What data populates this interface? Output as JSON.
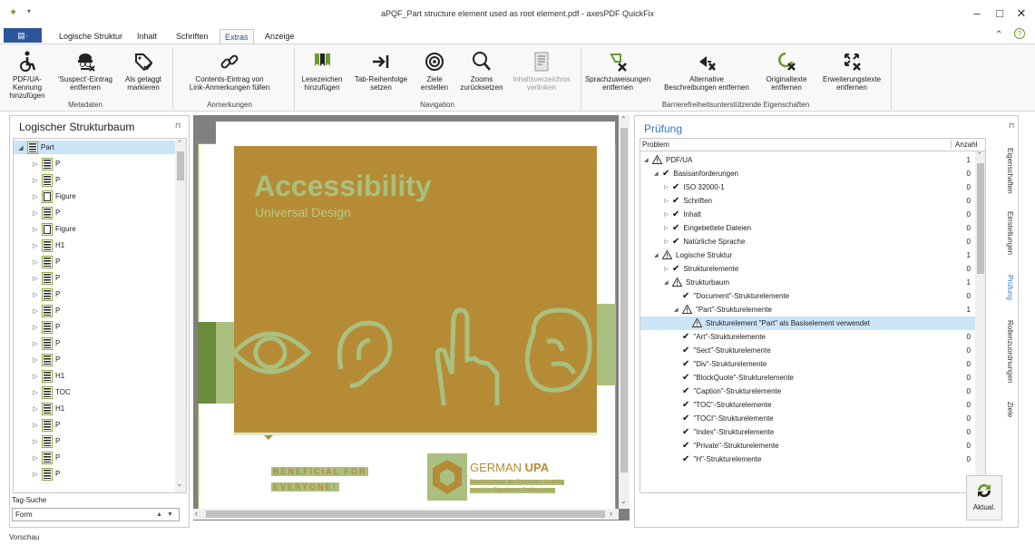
{
  "window": {
    "title": "aPQF_Part structure element used as root element.pdf - axesPDF QuickFix",
    "minimize": "–",
    "maximize": "□",
    "close": "✕"
  },
  "tabs": {
    "file": "▤·",
    "items": [
      "Logische Struktur",
      "Inhalt",
      "Schriften",
      "Extras",
      "Anzeige"
    ],
    "active": "Extras"
  },
  "ribbon": {
    "groups": [
      {
        "label": "Metadaten",
        "buttons": [
          {
            "l1": "PDF/UA-Kennung",
            "l2": "hinzufügen",
            "icon": "accessibility-icon"
          },
          {
            "l1": "'Suspect'-Eintrag",
            "l2": "entfernen",
            "icon": "spy-icon"
          },
          {
            "l1": "Als getaggt",
            "l2": "markieren",
            "icon": "tag-icon"
          }
        ]
      },
      {
        "label": "Anmerkungen",
        "buttons": [
          {
            "l1": "Contents-Eintrag von",
            "l2": "Link-Anmerkungen füllen",
            "icon": "link-icon"
          }
        ]
      },
      {
        "label": "Navigation",
        "buttons": [
          {
            "l1": "Lesezeichen",
            "l2": "hinzufügen",
            "icon": "bookmark-icon"
          },
          {
            "l1": "Tab-Reihenfolge",
            "l2": "setzen",
            "icon": "tab-order-icon"
          },
          {
            "l1": "Ziele",
            "l2": "erstellen",
            "icon": "target-icon"
          },
          {
            "l1": "Zooms",
            "l2": "zurücksetzen",
            "icon": "zoom-icon"
          },
          {
            "l1": "Inhaltsverzeichnis",
            "l2": "verlinken",
            "icon": "toc-icon",
            "disabled": true
          }
        ]
      },
      {
        "label": "Barrierefreiheitsunterstützende Eigenschaften",
        "buttons": [
          {
            "l1": "Sprachzuweisungen",
            "l2": "entfernen",
            "icon": "language-remove-icon"
          },
          {
            "l1": "Alternative",
            "l2": "Beschreibungen entfernen",
            "icon": "alt-remove-icon"
          },
          {
            "l1": "Originaltexte",
            "l2": "entfernen",
            "icon": "original-remove-icon"
          },
          {
            "l1": "Erweiterungstexte",
            "l2": "entfernen",
            "icon": "expansion-remove-icon"
          }
        ]
      }
    ]
  },
  "left": {
    "title": "Logischer Strukturbaum",
    "pin": "⊓",
    "tree": [
      {
        "label": "Part",
        "level": 0,
        "expanded": true,
        "selected": true,
        "kind": "part"
      },
      {
        "label": "P",
        "level": 1,
        "kind": "p"
      },
      {
        "label": "P",
        "level": 1,
        "kind": "p"
      },
      {
        "label": "Figure",
        "level": 1,
        "kind": "fig"
      },
      {
        "label": "P",
        "level": 1,
        "kind": "p"
      },
      {
        "label": "Figure",
        "level": 1,
        "kind": "fig"
      },
      {
        "label": "H1",
        "level": 1,
        "kind": "h"
      },
      {
        "label": "P",
        "level": 1,
        "kind": "p"
      },
      {
        "label": "P",
        "level": 1,
        "kind": "p"
      },
      {
        "label": "P",
        "level": 1,
        "kind": "p"
      },
      {
        "label": "P",
        "level": 1,
        "kind": "p"
      },
      {
        "label": "P",
        "level": 1,
        "kind": "p"
      },
      {
        "label": "P",
        "level": 1,
        "kind": "p"
      },
      {
        "label": "P",
        "level": 1,
        "kind": "p"
      },
      {
        "label": "H1",
        "level": 1,
        "kind": "h"
      },
      {
        "label": "TOC",
        "level": 1,
        "kind": "toc"
      },
      {
        "label": "H1",
        "level": 1,
        "kind": "h"
      },
      {
        "label": "P",
        "level": 1,
        "kind": "p"
      },
      {
        "label": "P",
        "level": 1,
        "kind": "p"
      },
      {
        "label": "P",
        "level": 1,
        "kind": "p"
      },
      {
        "label": "P",
        "level": 1,
        "kind": "p"
      }
    ],
    "tag_search_label": "Tag-Suche",
    "tag_search_value": "Form"
  },
  "document": {
    "heading": "Accessibility",
    "subheading": "Universal Design",
    "slogan1": "BENEFICIAL FOR",
    "slogan2": "EVERYONE!",
    "org_name1": "GERMAN ",
    "org_name2": "UPA",
    "org_line1": "Berufsverband der Deutschen Usability",
    "org_line2": "und User Experience Professionals",
    "colors": {
      "brown": "#b58c35",
      "green": "#a9c080",
      "darkgreen": "#6a8a3c"
    }
  },
  "right": {
    "title": "Prüfung",
    "pin": "⊓",
    "col_problem": "Problem",
    "col_count": "Anzahl",
    "rows": [
      {
        "label": "PDF/UA",
        "indent": 0,
        "status": "warn",
        "arrow": "◢",
        "count": "1"
      },
      {
        "label": "Basisanforderungen",
        "indent": 1,
        "status": "ok",
        "arrow": "◢",
        "count": "0"
      },
      {
        "label": "ISO 32000-1",
        "indent": 2,
        "status": "ok",
        "arrow": "▷",
        "count": "0"
      },
      {
        "label": "Schriften",
        "indent": 2,
        "status": "ok",
        "arrow": "▷",
        "count": "0"
      },
      {
        "label": "Inhalt",
        "indent": 2,
        "status": "ok",
        "arrow": "▷",
        "count": "0"
      },
      {
        "label": "Eingebettete Dateien",
        "indent": 2,
        "status": "ok",
        "arrow": "▷",
        "count": "0"
      },
      {
        "label": "Natürliche Sprache",
        "indent": 2,
        "status": "ok",
        "arrow": "▷",
        "count": "0"
      },
      {
        "label": "Logische Struktur",
        "indent": 1,
        "status": "warn",
        "arrow": "◢",
        "count": "1"
      },
      {
        "label": "Strukturelemente",
        "indent": 2,
        "status": "ok",
        "arrow": "▷",
        "count": "0"
      },
      {
        "label": "Strukturbaum",
        "indent": 2,
        "status": "warn",
        "arrow": "◢",
        "count": "1"
      },
      {
        "label": "\"Document\"-Strukturelemente",
        "indent": 3,
        "status": "ok",
        "arrow": "",
        "count": "0"
      },
      {
        "label": "\"Part\"-Strukturelemente",
        "indent": 3,
        "status": "warn",
        "arrow": "◢",
        "count": "1"
      },
      {
        "label": "Strukturelement \"Part\" als Basiselement verwendet",
        "indent": 4,
        "status": "warn",
        "arrow": "",
        "count": "",
        "selected": true
      },
      {
        "label": "\"Art\"-Strukturelemente",
        "indent": 3,
        "status": "ok",
        "arrow": "",
        "count": "0"
      },
      {
        "label": "\"Sect\"-Strukturelemente",
        "indent": 3,
        "status": "ok",
        "arrow": "",
        "count": "0"
      },
      {
        "label": "\"Div\"-Strukturelemente",
        "indent": 3,
        "status": "ok",
        "arrow": "",
        "count": "0"
      },
      {
        "label": "\"BlockQuote\"-Strukturelemente",
        "indent": 3,
        "status": "ok",
        "arrow": "",
        "count": "0"
      },
      {
        "label": "\"Caption\"-Strukturelemente",
        "indent": 3,
        "status": "ok",
        "arrow": "",
        "count": "0"
      },
      {
        "label": "\"TOC\"-Strukturelemente",
        "indent": 3,
        "status": "ok",
        "arrow": "",
        "count": "0"
      },
      {
        "label": "\"TOCI\"-Strukturelemente",
        "indent": 3,
        "status": "ok",
        "arrow": "",
        "count": "0"
      },
      {
        "label": "\"Index\"-Strukturelemente",
        "indent": 3,
        "status": "ok",
        "arrow": "",
        "count": "0"
      },
      {
        "label": "\"Private\"-Strukturelemente",
        "indent": 3,
        "status": "ok",
        "arrow": "",
        "count": "0"
      },
      {
        "label": "\"H\"-Strukturelemente",
        "indent": 3,
        "status": "ok",
        "arrow": "",
        "count": "0"
      }
    ],
    "refresh_label": "Aktual.",
    "side_tabs": [
      "Eigenschaften",
      "Einstellungen",
      "Prüfung",
      "Rollenzuordnungen",
      "Ziele"
    ],
    "active_side_tab": "Prüfung"
  },
  "statusbar": {
    "text": "Vorschau"
  }
}
